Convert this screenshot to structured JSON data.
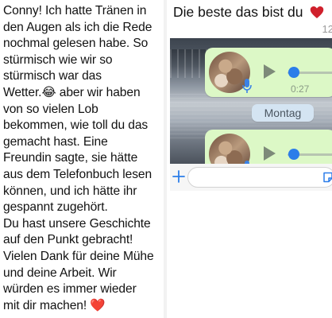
{
  "message": {
    "text": "Conny! Ich hatte Tränen in\nden Augen als ich die Rede\nnochmal gelesen habe. So\nstürmisch wie wir so\nstürmisch war das\nWetter.😂 aber wir haben\nvon so vielen Lob\nbekommen, wie toll du das\ngemacht hast. Eine\nFreundin sagte, sie hätte\naus dem Telefonbuch lesen\nkönnen, und ich hätte ihr\ngespannt zugehört.\nDu hast unsere Geschichte\nauf den Punkt gebracht!\nVielen Dank für deine Mühe\nund deine Arbeit. Wir\nwürden es immer wieder\nmit dir machen! ❤️"
  },
  "chat": {
    "caption": "Die beste das bist du",
    "caption_icon": "heart-icon",
    "time_partial": "12",
    "voice_messages": [
      {
        "duration": "0:27",
        "progress": 0.0
      },
      {
        "duration": "",
        "progress": 0.0
      }
    ],
    "date_separator": "Montag",
    "input": {
      "value": ""
    }
  },
  "colors": {
    "heart": "#d0202c",
    "bubble": "#dcf8c6",
    "accent": "#2b7de9",
    "date_pill": "#d4e4f2"
  }
}
